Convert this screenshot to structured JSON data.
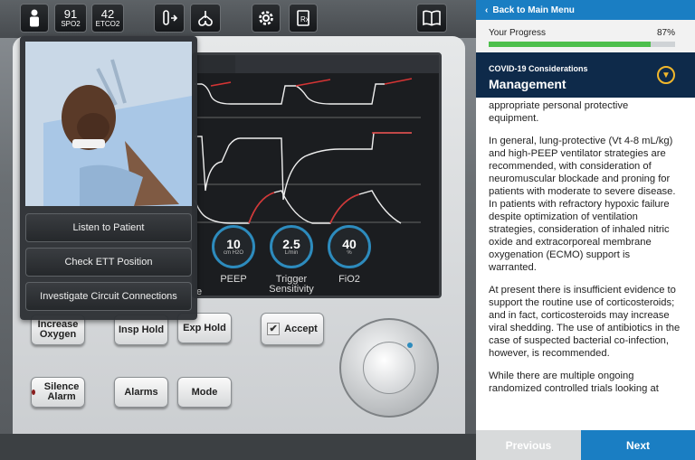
{
  "vitals": {
    "spo2": {
      "value": "91",
      "label": "SPO2"
    },
    "etco2": {
      "value": "42",
      "label": "ETCO2"
    }
  },
  "popup": {
    "buttons": [
      "Listen to Patient",
      "Check ETT Position",
      "Investigate Circuit Connections"
    ]
  },
  "ventilator": {
    "dials": [
      {
        "value": "10",
        "unit": "cm H2O",
        "label": "PEEP"
      },
      {
        "value": "2.5",
        "unit": "L/min",
        "label": "Trigger Sensitivity"
      },
      {
        "value": "40",
        "unit": "%",
        "label": "FiO2"
      }
    ],
    "partial_label": "e",
    "buttons": {
      "increase_oxygen": "Increase Oxygen",
      "insp_hold": "Insp Hold",
      "exp_hold": "Exp Hold",
      "accept": "Accept",
      "silence_alarm": "Silence Alarm",
      "alarms": "Alarms",
      "mode": "Mode"
    }
  },
  "panel": {
    "back_label": "Back to Main Menu",
    "progress_label": "Your Progress",
    "progress_pct": "87%",
    "progress_value": 87,
    "section_sub": "COVID-19 Considerations",
    "section_title": "Management",
    "paragraphs": [
      "appropriate personal protective equipment.",
      "In general, lung-protective (Vt 4-8 mL/kg) and high-PEEP ventilator strategies are recommended, with consideration of neuromuscular blockade and proning for patients with moderate to severe disease. In patients with refractory hypoxic failure despite optimization of ventilation strategies, consideration of inhaled nitric oxide and extracorporeal membrane oxygenation (ECMO) support is warranted.",
      "At present there is insufficient evidence to support the routine use of corticosteroids; and in fact, corticosteroids may increase viral shedding. The use of antibiotics in the case of suspected bacterial co-infection, however, is recommended.",
      "While there are multiple ongoing randomized controlled trials looking at"
    ],
    "previous_label": "Previous",
    "next_label": "Next"
  },
  "colors": {
    "accent": "#1a7ec3",
    "progress": "#4dbf4c",
    "header": "#0e2a4a",
    "chevron": "#f1b72c"
  }
}
